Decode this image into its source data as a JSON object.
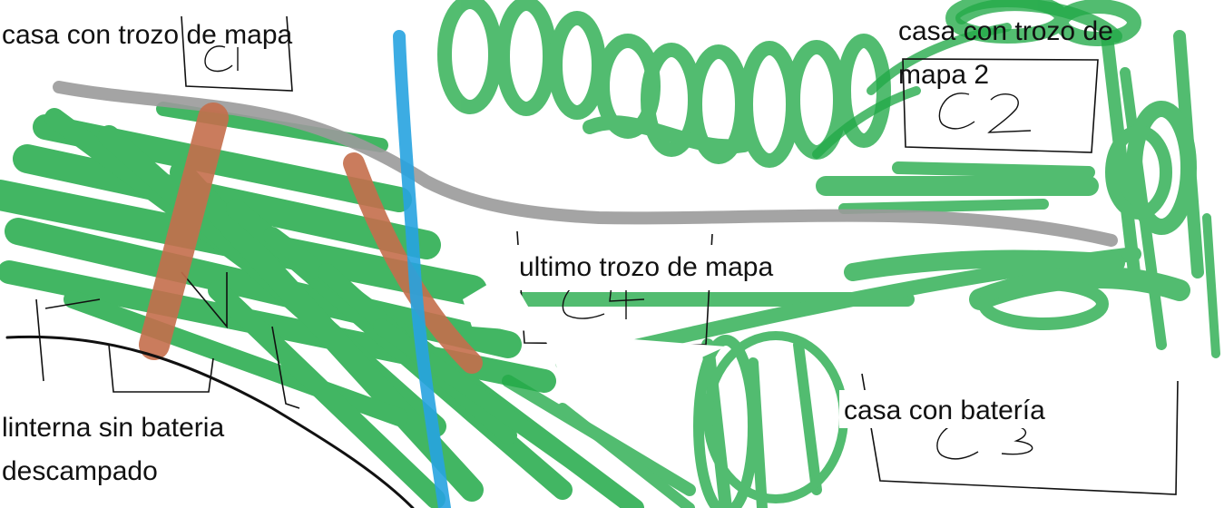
{
  "labels": {
    "house_map_piece": "casa con trozo de mapa",
    "house_map_piece_2_line1": "casa con trozo de",
    "house_map_piece_2_line2": "mapa 2",
    "last_map_piece": "ultimo trozo de mapa",
    "house_battery": "casa con batería",
    "flashlight_line1": "linterna sin bateria",
    "flashlight_line2": "descampado"
  },
  "house_markers": {
    "c1": "C1",
    "c2": "C2",
    "c3": "C3",
    "c4": "C4"
  },
  "colors": {
    "background": "#ffffff",
    "vegetation": "#22aa48",
    "road": "#9a9a9a",
    "river": "#27a3e0",
    "bridge": "#c46e4b",
    "outline": "#111111"
  }
}
